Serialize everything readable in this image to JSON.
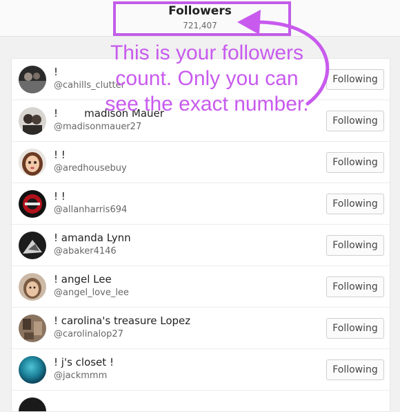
{
  "header": {
    "title": "Followers",
    "count": "721,407"
  },
  "annotation": {
    "text": "This is your followers count. Only you can see the exact number.",
    "color": "#c85aee"
  },
  "followers": [
    {
      "name": "!",
      "handle": "@cahills_clutter",
      "button": "Following"
    },
    {
      "name": "!        madison Mauer",
      "handle": "@madisonmauer27",
      "button": "Following"
    },
    {
      "name": "! !",
      "handle": "@aredhousebuy",
      "button": "Following"
    },
    {
      "name": "! !",
      "handle": "@allanharris694",
      "button": "Following"
    },
    {
      "name": "! amanda Lynn",
      "handle": "@abaker4146",
      "button": "Following"
    },
    {
      "name": "! angel Lee",
      "handle": "@angel_love_lee",
      "button": "Following"
    },
    {
      "name": "! carolina's treasure Lopez",
      "handle": "@carolinalop27",
      "button": "Following"
    },
    {
      "name": "! j's closet !",
      "handle": "@jackmmm",
      "button": "Following"
    }
  ]
}
